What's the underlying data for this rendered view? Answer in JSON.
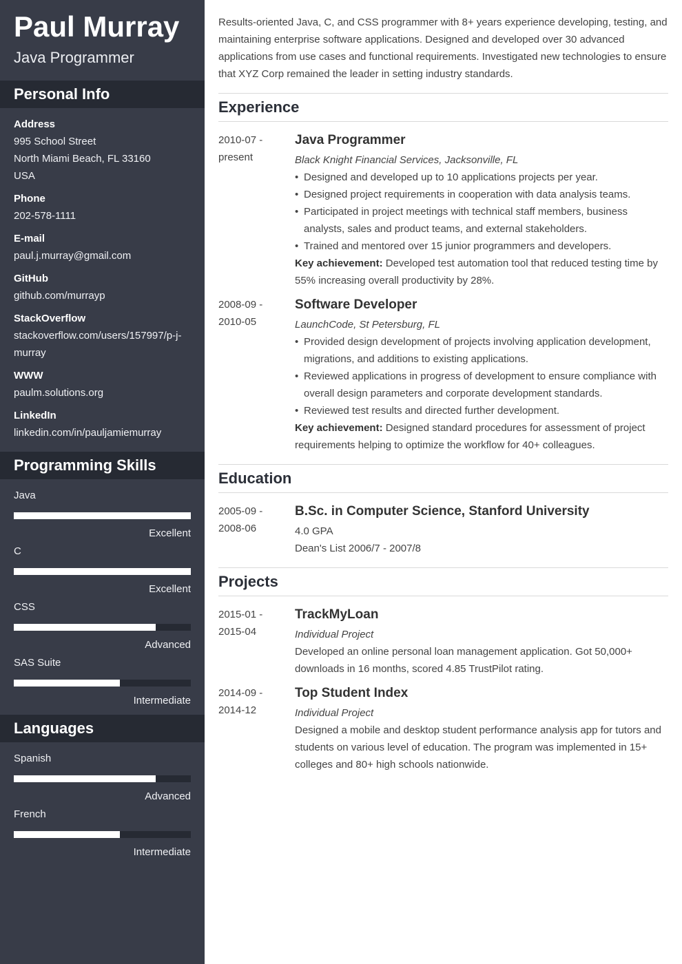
{
  "header": {
    "name": "Paul Murray",
    "role": "Java Programmer"
  },
  "sidebar": {
    "personal_info": {
      "title": "Personal Info",
      "fields": [
        {
          "label": "Address",
          "lines": [
            "995 School Street",
            "North Miami Beach, FL 33160",
            "USA"
          ]
        },
        {
          "label": "Phone",
          "lines": [
            "202-578-1111"
          ]
        },
        {
          "label": "E-mail",
          "lines": [
            "paul.j.murray@gmail.com"
          ]
        },
        {
          "label": "GitHub",
          "lines": [
            "github.com/murrayp"
          ]
        },
        {
          "label": "StackOverflow",
          "lines": [
            "stackoverflow.com/users/157997/p-j-murray"
          ]
        },
        {
          "label": "WWW",
          "lines": [
            "paulm.solutions.org"
          ]
        },
        {
          "label": "LinkedIn",
          "lines": [
            "linkedin.com/in/pauljamiemurray"
          ]
        }
      ]
    },
    "skills": {
      "title": "Programming Skills",
      "items": [
        {
          "name": "Java",
          "level": "Excellent",
          "fraction": 1.0
        },
        {
          "name": "C",
          "level": "Excellent",
          "fraction": 1.0
        },
        {
          "name": "CSS",
          "level": "Advanced",
          "fraction": 0.8
        },
        {
          "name": "SAS Suite",
          "level": "Intermediate",
          "fraction": 0.6
        }
      ]
    },
    "languages": {
      "title": "Languages",
      "items": [
        {
          "name": "Spanish",
          "level": "Advanced",
          "fraction": 0.8
        },
        {
          "name": "French",
          "level": "Intermediate",
          "fraction": 0.6
        }
      ]
    }
  },
  "main": {
    "summary": "Results-oriented Java, C, and CSS programmer with 8+ years experience developing, testing, and maintaining enterprise software applications. Designed and developed over 30 advanced applications from use cases and functional requirements. Investigated new technologies to ensure that XYZ Corp remained the leader in setting industry standards.",
    "experience": {
      "title": "Experience",
      "items": [
        {
          "date_start": "2010-07 -",
          "date_end": "present",
          "title": "Java Programmer",
          "company": "Black Knight Financial Services, Jacksonville, FL",
          "bullets": [
            "Designed and developed up to 10 applications projects per year.",
            "Designed project requirements in cooperation with data analysis teams.",
            "Participated in project meetings with technical staff members, business analysts, sales and product teams, and external stakeholders.",
            "Trained and mentored over 15 junior programmers and developers."
          ],
          "key_label": "Key achievement:",
          "key_text": " Developed test automation tool that reduced testing time by 55% increasing overall productivity by 28%."
        },
        {
          "date_start": "2008-09 -",
          "date_end": "2010-05",
          "title": "Software Developer",
          "company": "LaunchCode, St Petersburg, FL",
          "bullets": [
            "Provided design development of projects involving application development, migrations, and additions to existing applications.",
            "Reviewed applications in progress of development to ensure compliance with overall design parameters and corporate development standards.",
            "Reviewed test results and directed further development."
          ],
          "key_label": "Key achievement:",
          "key_text": " Designed standard procedures for assessment of project requirements helping to optimize the workflow for 40+ colleagues."
        }
      ]
    },
    "education": {
      "title": "Education",
      "items": [
        {
          "date_start": "2005-09 -",
          "date_end": "2008-06",
          "title": "B.Sc. in Computer Science, Stanford University",
          "lines": [
            "4.0 GPA",
            "Dean's List 2006/7 - 2007/8"
          ]
        }
      ]
    },
    "projects": {
      "title": "Projects",
      "items": [
        {
          "date_start": "2015-01 -",
          "date_end": "2015-04",
          "title": "TrackMyLoan",
          "sub": "Individual Project",
          "text": "Developed an online personal loan management application. Got 50,000+ downloads in 16 months, scored 4.85 TrustPilot rating."
        },
        {
          "date_start": "2014-09 -",
          "date_end": "2014-12",
          "title": "Top Student Index",
          "sub": "Individual Project",
          "text": "Designed a mobile and desktop student performance analysis app for tutors and students on various level of education. The program was implemented in 15+ colleges and 80+ high schools nationwide."
        }
      ]
    }
  }
}
